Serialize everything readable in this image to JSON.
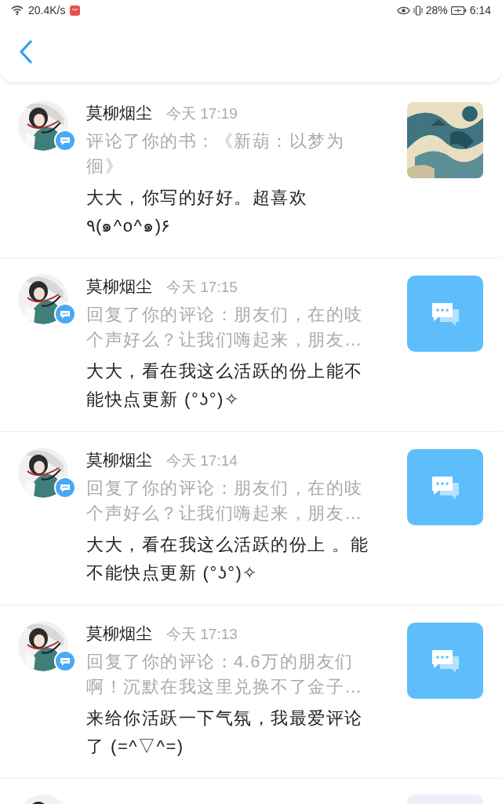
{
  "status_bar": {
    "speed": "20.4K/s",
    "battery": "28%",
    "time": "6:14"
  },
  "notifications": [
    {
      "name": "莫柳烟尘",
      "time": "今天 17:19",
      "summary": "评论了你的书：《新葫：以梦为徊》",
      "message": "大大，你写的好好。超喜欢 ٩(๑^o^๑)۶",
      "kind": "picture"
    },
    {
      "name": "莫柳烟尘",
      "time": "今天 17:15",
      "summary": "回复了你的评论：朋友们，在的吱个声好么？让我们嗨起来，朋友…",
      "message": "大大，看在我这么活跃的份上能不能快点更新 (°ʖ°)✧",
      "kind": "comment"
    },
    {
      "name": "莫柳烟尘",
      "time": "今天 17:14",
      "summary": "回复了你的评论：朋友们，在的吱个声好么？让我们嗨起来，朋友…",
      "message": "大大，看在我这么活跃的份上 。能不能快点更新 (°ʖ°)✧",
      "kind": "comment"
    },
    {
      "name": "莫柳烟尘",
      "time": "今天 17:13",
      "summary": "回复了你的评论：4.6万的朋友们啊！沉默在我这里兑换不了金子…",
      "message": "来给你活跃一下气氛，我最爱评论了 (=^▽^=)",
      "kind": "comment"
    }
  ]
}
